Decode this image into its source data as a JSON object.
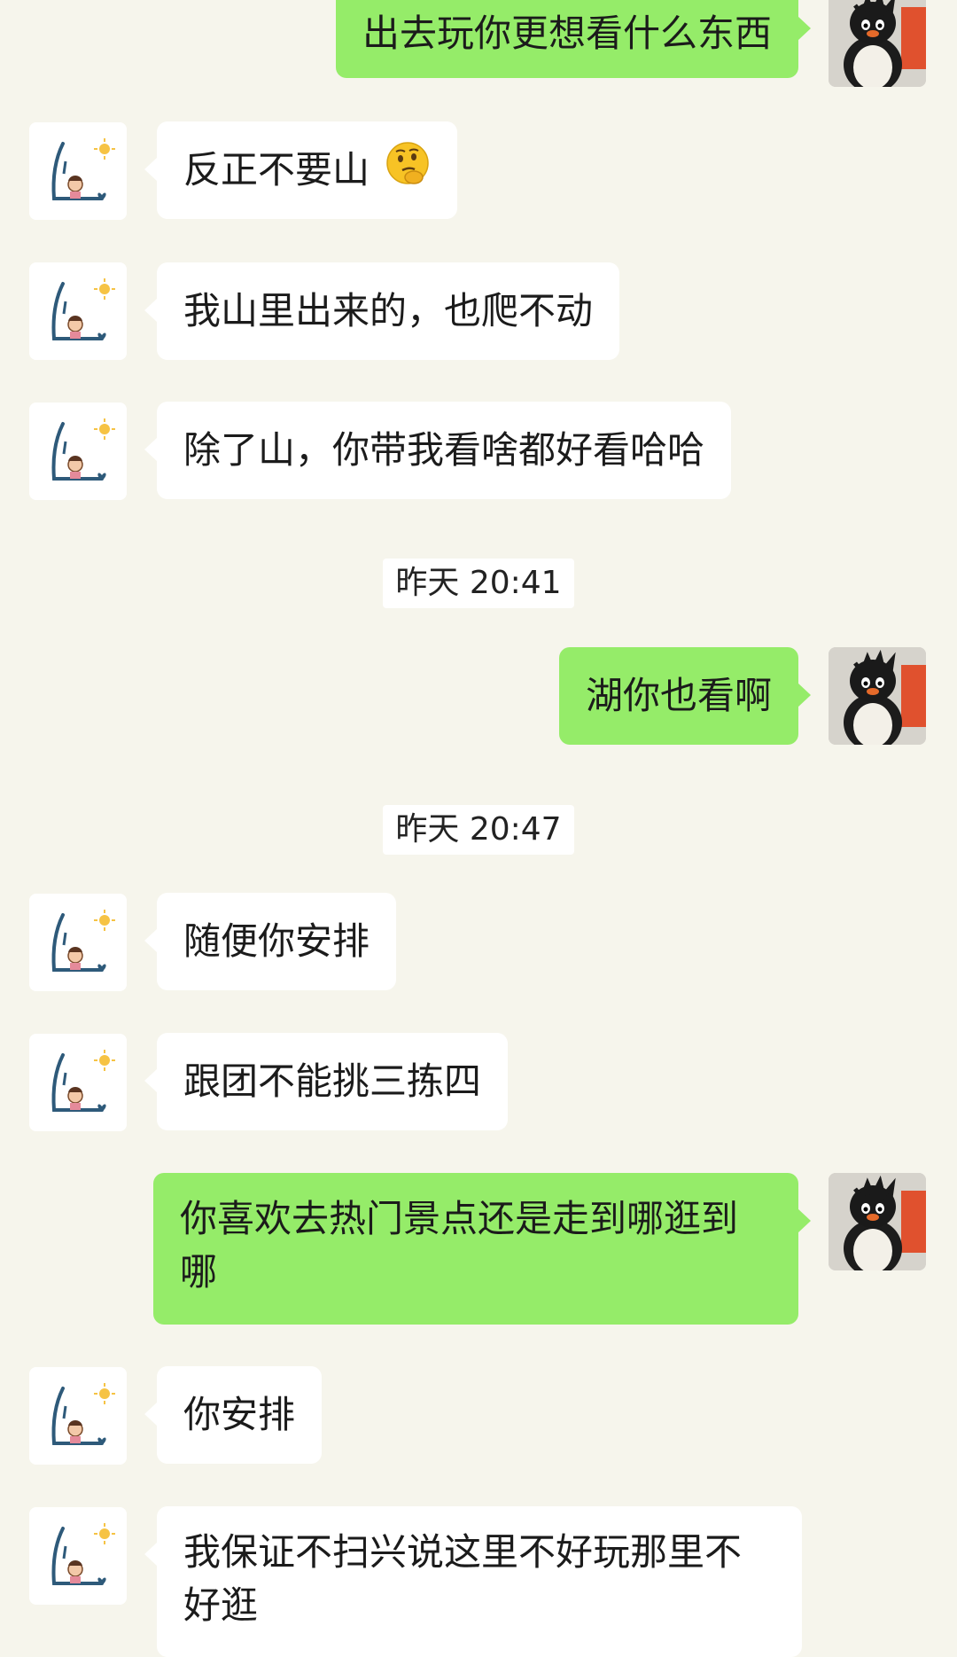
{
  "contacts": {
    "self_avatar": "penguin-plush-avatar",
    "other_avatar": "sketch-girl-avatar"
  },
  "colors": {
    "background": "#f6f5ec",
    "outgoing_bubble": "#95ec69",
    "incoming_bubble": "#ffffff"
  },
  "messages": [
    {
      "type": "msg",
      "side": "out",
      "text": "出去玩你更想看什么东西"
    },
    {
      "type": "msg",
      "side": "in",
      "text": "反正不要山",
      "emoji": "thinking-face-emoji"
    },
    {
      "type": "msg",
      "side": "in",
      "text": "我山里出来的，也爬不动"
    },
    {
      "type": "msg",
      "side": "in",
      "text": "除了山，你带我看啥都好看哈哈"
    },
    {
      "type": "time",
      "text": "昨天 20:41"
    },
    {
      "type": "msg",
      "side": "out",
      "text": "湖你也看啊"
    },
    {
      "type": "time",
      "text": "昨天 20:47"
    },
    {
      "type": "msg",
      "side": "in",
      "text": "随便你安排"
    },
    {
      "type": "msg",
      "side": "in",
      "text": "跟团不能挑三拣四"
    },
    {
      "type": "msg",
      "side": "out",
      "text": "你喜欢去热门景点还是走到哪逛到哪"
    },
    {
      "type": "msg",
      "side": "in",
      "text": "你安排"
    },
    {
      "type": "msg",
      "side": "in",
      "text": "我保证不扫兴说这里不好玩那里不好逛"
    }
  ]
}
